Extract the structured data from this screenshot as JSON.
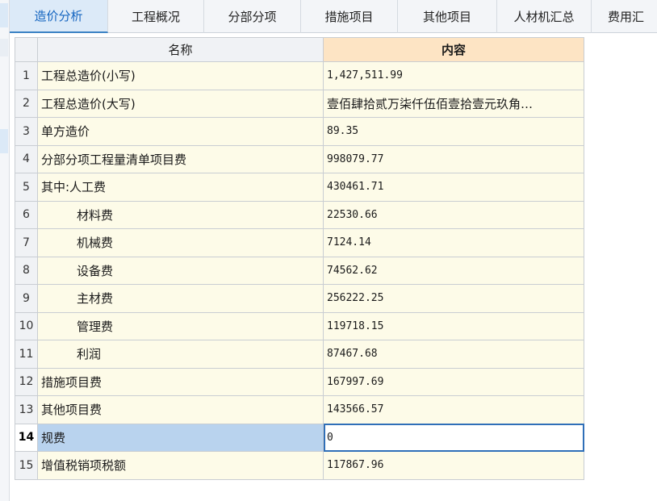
{
  "tabs": [
    {
      "label": "造价分析",
      "active": true
    },
    {
      "label": "工程概况",
      "active": false
    },
    {
      "label": "分部分项",
      "active": false
    },
    {
      "label": "措施项目",
      "active": false
    },
    {
      "label": "其他项目",
      "active": false
    },
    {
      "label": "人材机汇总",
      "active": false
    },
    {
      "label": "费用汇",
      "active": false
    }
  ],
  "table": {
    "headers": {
      "name": "名称",
      "content": "内容"
    },
    "rows": [
      {
        "index": "1",
        "name": "工程总造价(小写)",
        "value": "1,427,511.99"
      },
      {
        "index": "2",
        "name": "工程总造价(大写)",
        "value": "壹佰肆拾贰万柒仟伍佰壹拾壹元玖角…"
      },
      {
        "index": "3",
        "name": "单方造价",
        "value": "89.35"
      },
      {
        "index": "4",
        "name": "分部分项工程量清单项目费",
        "value": "998079.77"
      },
      {
        "index": "5",
        "name": "其中:人工费",
        "value": "430461.71"
      },
      {
        "index": "6",
        "name": "材料费",
        "value": "22530.66"
      },
      {
        "index": "7",
        "name": "机械费",
        "value": "7124.14"
      },
      {
        "index": "8",
        "name": "设备费",
        "value": "74562.62"
      },
      {
        "index": "9",
        "name": "主材费",
        "value": "256222.25"
      },
      {
        "index": "10",
        "name": "管理费",
        "value": "119718.15"
      },
      {
        "index": "11",
        "name": "利润",
        "value": "87467.68"
      },
      {
        "index": "12",
        "name": "措施项目费",
        "value": "167997.69"
      },
      {
        "index": "13",
        "name": "其他项目费",
        "value": "143566.57"
      },
      {
        "index": "14",
        "name": "规费",
        "value": "0"
      },
      {
        "index": "15",
        "name": "增值税销项税额",
        "value": "117867.96"
      }
    ]
  },
  "colors": {
    "active_tab_bg": "#dceaf8",
    "active_tab_text": "#1565c0",
    "header_content_bg": "#fde4c4",
    "cell_bg": "#fdfbe8",
    "selected_name_bg": "#b9d3ee",
    "selected_border": "#2f6fb8"
  }
}
